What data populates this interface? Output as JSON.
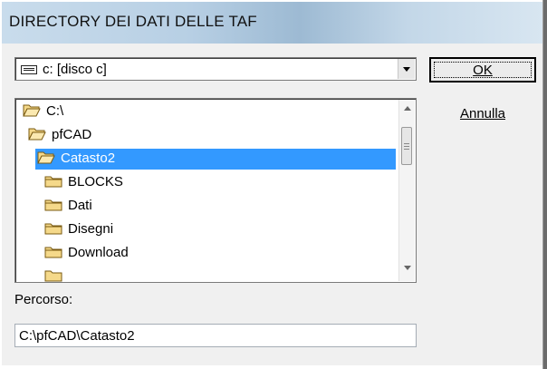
{
  "window": {
    "title": "DIRECTORY DEI DATI DELLE TAF"
  },
  "drive": {
    "icon": "drive-icon",
    "value": "c: [disco c]"
  },
  "buttons": {
    "ok": "OK",
    "cancel": "Annulla"
  },
  "folders": [
    {
      "label": "C:\\",
      "icon": "open-folder-icon",
      "selected": false
    },
    {
      "label": "pfCAD",
      "icon": "open-folder-icon",
      "selected": false
    },
    {
      "label": "Catasto2",
      "icon": "open-folder-icon",
      "selected": true
    },
    {
      "label": "BLOCKS",
      "icon": "folder-icon",
      "selected": false
    },
    {
      "label": "Dati",
      "icon": "folder-icon",
      "selected": false
    },
    {
      "label": "Disegni",
      "icon": "folder-icon",
      "selected": false
    },
    {
      "label": "Download",
      "icon": "folder-icon",
      "selected": false
    }
  ],
  "path": {
    "label": "Percorso:",
    "value": "C:\\pfCAD\\Catasto2"
  },
  "colors": {
    "selection": "#3399ff",
    "folder": "#f5d98a"
  }
}
